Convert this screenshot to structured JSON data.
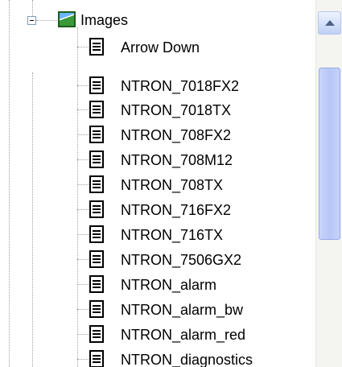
{
  "tree": {
    "folder_label": "Images",
    "items": [
      "Arrow Down",
      "NTRON_7018FX2",
      "NTRON_7018TX",
      "NTRON_708FX2",
      "NTRON_708M12",
      "NTRON_708TX",
      "NTRON_716FX2",
      "NTRON_716TX",
      "NTRON_7506GX2",
      "NTRON_alarm",
      "NTRON_alarm_bw",
      "NTRON_alarm_red",
      "NTRON_diagnostics"
    ]
  },
  "icons": {
    "folder": "image-folder-icon",
    "item": "document-icon",
    "toggle": "collapse-minus-icon",
    "scroll_up": "scroll-up-arrow-icon"
  },
  "scrollbar": {
    "position_fraction": 0.18
  }
}
